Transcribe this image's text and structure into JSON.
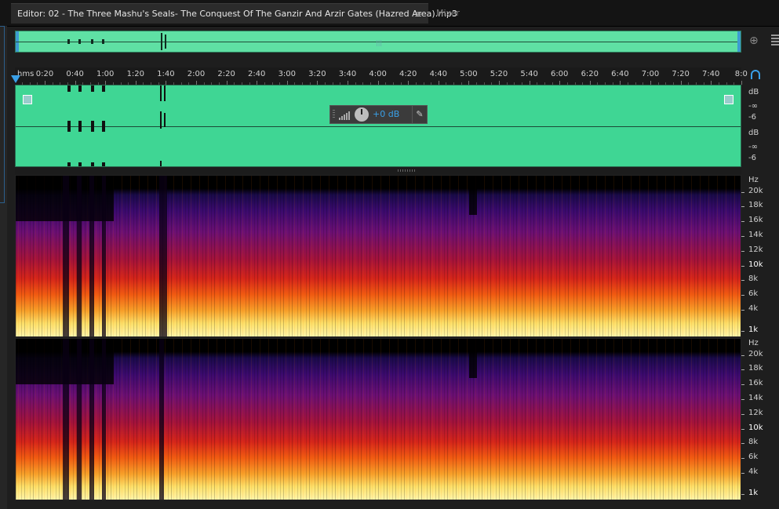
{
  "tabs": {
    "editor_label": "Editor: 02 - The Three Mashu's Seals- The Conquest Of The Ganzir And Arzir Gates (Hazred Area).mp3",
    "editor_menu_glyph": "≡",
    "mixer_label": "Mixer"
  },
  "ruler": {
    "unit_label": "hms",
    "ticks": [
      "0:20",
      "0:40",
      "1:00",
      "1:20",
      "1:40",
      "2:00",
      "2:20",
      "2:40",
      "3:00",
      "3:20",
      "3:40",
      "4:00",
      "4:20",
      "4:40",
      "5:00",
      "5:20",
      "5:40",
      "6:00",
      "6:20",
      "6:40",
      "7:00",
      "7:20",
      "7:40",
      "8:0"
    ]
  },
  "level_hud": {
    "value": "+0 dB",
    "pin_glyph": "✎"
  },
  "db_scale": {
    "channel1": [
      "dB",
      "-∞",
      "-6"
    ],
    "channel2": [
      "dB",
      "-∞",
      "-6"
    ]
  },
  "hz_scale": {
    "unit": "Hz",
    "labels": [
      "20k",
      "18k",
      "16k",
      "14k",
      "12k",
      "10k",
      "8k",
      "6k",
      "4k",
      "1k"
    ]
  },
  "icons": {
    "zoom": "zoom-icon",
    "headphone": "headphone-icon",
    "panel": "panel-menu-icon"
  },
  "colors": {
    "waveform": "#3fd694",
    "accent": "#3aa0e8"
  }
}
